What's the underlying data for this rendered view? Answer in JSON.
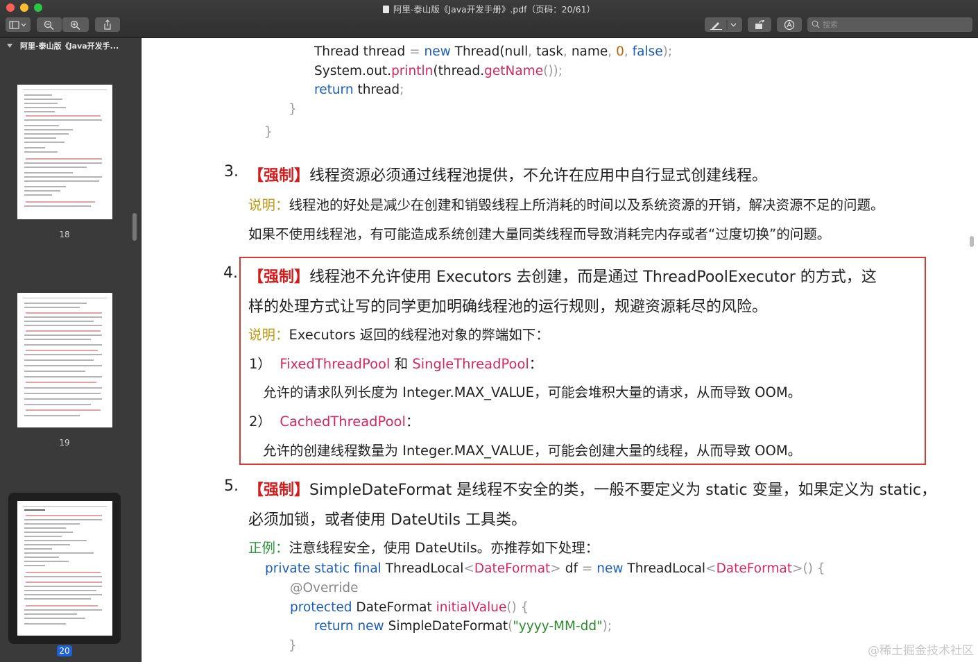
{
  "window": {
    "title": "阿里-泰山版《Java开发手册》.pdf（页码：20/61）"
  },
  "toolbar": {
    "sidebar_toggle_icon": "sidebar-icon",
    "zoom_out_icon": "zoom-out-icon",
    "zoom_in_icon": "zoom-in-icon",
    "share_icon": "share-icon",
    "markup_icon": "pen-icon",
    "rotate_icon": "rotate-icon",
    "annotate_icon": "annotate-icon",
    "search_placeholder": "搜索"
  },
  "sidebar": {
    "doc_title": "阿里-泰山版《Java开发手...",
    "pages": [
      {
        "number": "18"
      },
      {
        "number": "19"
      },
      {
        "number": "20",
        "selected": true
      }
    ]
  },
  "document": {
    "code_top": {
      "line1_a": "Thread thread",
      "line1_eq": "=",
      "line1_new": "new",
      "line1_b": "Thread",
      "line1_c": "(null",
      "line1_d": ",",
      "line1_e": "task",
      "line1_f": ",",
      "line1_g": "name",
      "line1_h": ",",
      "line1_num": "0",
      "line1_i": ",",
      "line1_false": "false",
      "line1_end": ");",
      "line2_a": "System",
      "line2_b": ".out.",
      "line2_fn": "println",
      "line2_c": "(thread.",
      "line2_fn2": "getName",
      "line2_end": "());",
      "line3_kw": "return",
      "line3_b": "thread",
      "line3_end": ";",
      "brace1": "}",
      "brace2": "}"
    },
    "items": [
      {
        "number": "3.",
        "tag": "【强制】",
        "text": "线程资源必须通过线程池提供，不允许在应用中自行显式创建线程。",
        "note_label": "说明：",
        "note_text": "线程池的好处是减少在创建和销毁线程上所消耗的时间以及系统资源的开销，解决资源不足的问题。",
        "note_text2": "如果不使用线程池，有可能造成系统创建大量同类线程而导致消耗完内存或者“过度切换”的问题。"
      },
      {
        "number": "4.",
        "tag": "【强制】",
        "text": "线程池不允许使用 Executors 去创建，而是通过 ThreadPoolExecutor 的方式，这",
        "text2": "样的处理方式让写的同学更加明确线程池的运行规则，规避资源耗尽的风险。",
        "note_label": "说明：",
        "note_text": "Executors 返回的线程池对象的弊端如下：",
        "sub1_no": "1）",
        "sub1_a": "FixedThreadPool",
        "sub1_and": "和",
        "sub1_b": "SingleThreadPool",
        "sub1_colon": "：",
        "sub1_desc": "允许的请求队列长度为 Integer.MAX_VALUE，可能会堆积大量的请求，从而导致 OOM。",
        "sub2_no": "2）",
        "sub2_a": "CachedThreadPool",
        "sub2_colon": "：",
        "sub2_desc": "允许的创建线程数量为 Integer.MAX_VALUE，可能会创建大量的线程，从而导致 OOM。"
      },
      {
        "number": "5.",
        "tag": "【强制】",
        "text": "SimpleDateFormat  是线程不安全的类，一般不要定义为 static 变量，如果定义为 static，",
        "text2": "必须加锁，或者使用 DateUtils 工具类。",
        "good_label": "正例：",
        "good_text": "注意线程安全，使用 DateUtils。亦推荐如下处理："
      }
    ],
    "code_bottom": {
      "l1_kw": "private static final",
      "l1_a": "ThreadLocal",
      "l1_lt": "<",
      "l1_type": "DateFormat",
      "l1_gt": ">",
      "l1_b": "df",
      "l1_eq": "=",
      "l1_new": "new",
      "l1_c": "ThreadLocal",
      "l1_lt2": "<",
      "l1_type2": "DateFormat",
      "l1_end": ">() {",
      "l2": "@Override",
      "l3_kw": "protected",
      "l3_a": "DateFormat",
      "l3_fn": "initialValue",
      "l3_end": "() {",
      "l4_kw": "return new",
      "l4_a": "SimpleDateFormat",
      "l4_p": "(",
      "l4_str": "\"yyyy-MM-dd\"",
      "l4_end": ");",
      "l5": "}"
    },
    "watermark": "@稀土掘金技术社区"
  }
}
